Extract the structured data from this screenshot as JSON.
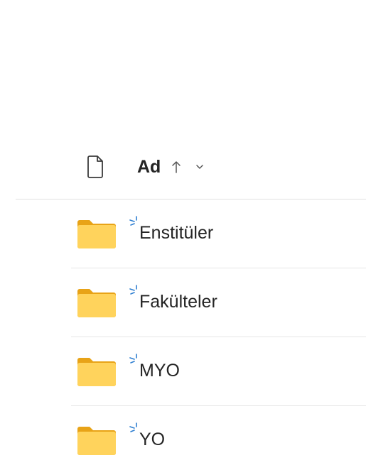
{
  "list_header": {
    "name_column_label": "Ad",
    "sort_direction_icon": "arrow-up-icon",
    "sort_menu_icon": "chevron-down-icon",
    "file_type_icon": "document-icon"
  },
  "items": [
    {
      "name": "Enstitüler",
      "icon": "folder-icon",
      "badge_icon": "new-item-sparkle-icon"
    },
    {
      "name": "Fakülteler",
      "icon": "folder-icon",
      "badge_icon": "new-item-sparkle-icon"
    },
    {
      "name": "MYO",
      "icon": "folder-icon",
      "badge_icon": "new-item-sparkle-icon"
    },
    {
      "name": "YO",
      "icon": "folder-icon",
      "badge_icon": "new-item-sparkle-icon"
    }
  ],
  "colors": {
    "folder_front": "#FFD35C",
    "folder_back": "#E8A317",
    "new_badge": "#2F7FD1",
    "divider": "#E1E1E1"
  }
}
